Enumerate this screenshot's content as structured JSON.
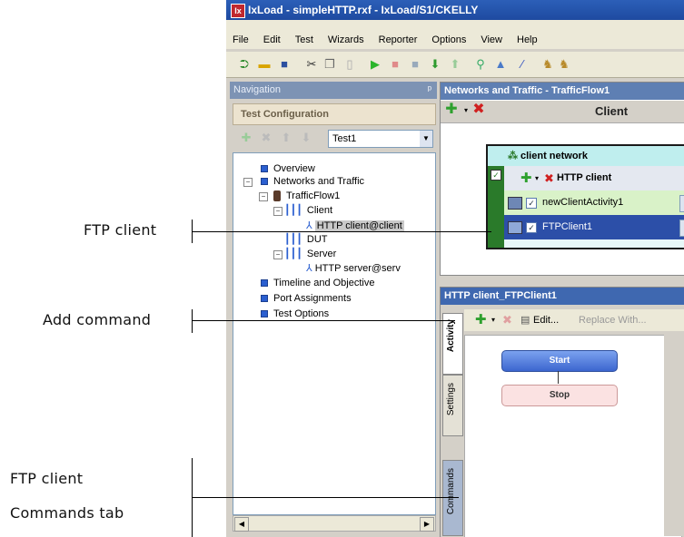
{
  "window": {
    "title": "IxLoad - simpleHTTP.rxf - IxLoad/S1/CKELLY",
    "icon": "ixload-app-icon"
  },
  "menu": [
    "File",
    "Edit",
    "Test",
    "Wizards",
    "Reporter",
    "Options",
    "View",
    "Help"
  ],
  "toolbar": {
    "icons": [
      "import-icon",
      "open-folder-icon",
      "save-icon",
      "cut-icon",
      "copy-icon",
      "paste-icon",
      "run-icon",
      "stop-icon",
      "pause-icon",
      "download-icon",
      "upload-icon",
      "search-icon",
      "analyzer-icon",
      "pen-icon",
      "wizard-icon"
    ]
  },
  "navigation": {
    "header": "Navigation",
    "pin": "ᵖ",
    "section": "Test Configuration",
    "test_select": "Test1",
    "tree": {
      "overview": "Overview",
      "networks": "Networks and Traffic",
      "trafficflow": "TrafficFlow1",
      "client": "Client",
      "http_client": "HTTP client@client",
      "dut": "DUT",
      "server": "Server",
      "http_server": "HTTP server@serv",
      "timeline": "Timeline and Objective",
      "ports": "Port Assignments",
      "options": "Test Options"
    }
  },
  "networks_panel": {
    "header": "Networks and Traffic - TrafficFlow1",
    "column": "Client",
    "network_name": "client network",
    "activity_group": "HTTP client",
    "activities": [
      "newClientActivity1",
      "FTPClient1"
    ]
  },
  "activity_panel": {
    "header": "HTTP client_FTPClient1",
    "tabs": [
      "Activity",
      "Settings",
      "Commands"
    ],
    "buttons": {
      "edit": "Edit...",
      "replace": "Replace With..."
    },
    "flow": {
      "start": "Start",
      "stop": "Stop"
    }
  },
  "annotations": {
    "ftp_client": "FTP client",
    "add_command": "Add command",
    "ftp_client_2": "FTP client",
    "commands_tab": "Commands tab"
  },
  "colors": {
    "title_bar": "#1e4aa0",
    "nav_header": "#7d93b4",
    "network_border": "#1a1a1a",
    "selected_row": "#2c4fa8",
    "start_node": "#3c66cf",
    "stop_node": "#fbe2e2"
  }
}
